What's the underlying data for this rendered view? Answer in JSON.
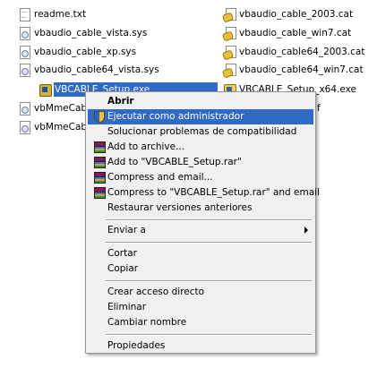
{
  "files_left": [
    {
      "name": "readme.txt",
      "icon": "document-icon"
    },
    {
      "name": "vbaudio_cable_vista.sys",
      "icon": "system-file-icon"
    },
    {
      "name": "vbaudio_cable_xp.sys",
      "icon": "system-file-icon"
    },
    {
      "name": "vbaudio_cable64_vista.sys",
      "icon": "system-file-icon"
    },
    {
      "name": "VBCABLE_Setup.exe",
      "icon": "vbcable-exe-icon",
      "selected": true
    },
    {
      "name": "vbMmeCable",
      "icon": "system-file-icon"
    },
    {
      "name": "vbMmeCable",
      "icon": "system-file-icon"
    }
  ],
  "files_right": [
    {
      "name": "vbaudio_cable_2003.cat",
      "icon": "catalog-icon"
    },
    {
      "name": "vbaudio_cable_win7.cat",
      "icon": "catalog-icon"
    },
    {
      "name": "vbaudio_cable64_2003.cat",
      "icon": "catalog-icon"
    },
    {
      "name": "vbaudio_cable64_win7.cat",
      "icon": "catalog-icon"
    },
    {
      "name": "VBCABLE_Setup_x64.exe",
      "icon": "vbcable-exe-icon"
    },
    {
      "name": "f",
      "icon": ""
    }
  ],
  "menu": {
    "open": "Abrir",
    "run_as_admin": "Ejecutar como administrador",
    "troubleshoot_compat": "Solucionar problemas de compatibilidad",
    "add_to_archive": "Add to archive...",
    "add_to_rar": "Add to \"VBCABLE_Setup.rar\"",
    "compress_email": "Compress and email...",
    "compress_rar_email": "Compress to \"VBCABLE_Setup.rar\" and email",
    "restore_versions": "Restaurar versiones anteriores",
    "send_to": "Enviar a",
    "cut": "Cortar",
    "copy": "Copiar",
    "create_shortcut": "Crear acceso directo",
    "delete": "Eliminar",
    "rename": "Cambiar nombre",
    "properties": "Propiedades"
  }
}
